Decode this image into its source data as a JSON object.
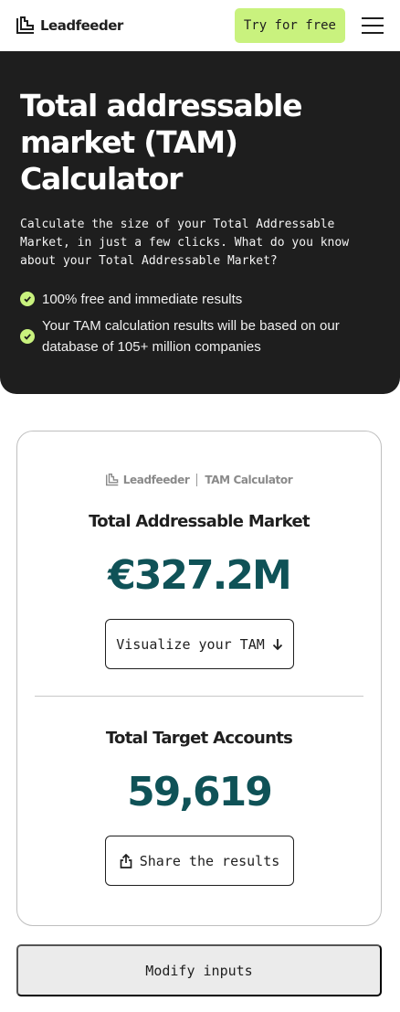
{
  "header": {
    "brand": "Leadfeeder",
    "try_label": "Try for free"
  },
  "hero": {
    "title": "Total addressable market (TAM) Calculator",
    "description": "Calculate the size of your Total Addressable Market, in just a few clicks. What do you know about your Total Addressable Market?",
    "bullets": [
      "100% free and immediate results",
      "Your TAM calculation results will be based on our database of 105+ million companies"
    ]
  },
  "card": {
    "brand": "Leadfeeder",
    "product": "TAM Calculator",
    "tam_title": "Total Addressable Market",
    "tam_value": "€327.2M",
    "visualize_label": "Visualize your TAM",
    "accounts_title": "Total Target Accounts",
    "accounts_value": "59,619",
    "share_label": "Share the results"
  },
  "footer": {
    "modify_label": "Modify inputs"
  },
  "colors": {
    "accent": "#c9f27e",
    "hero_bg": "#1e1e1e",
    "number": "#0f5257"
  },
  "icons": [
    "leadfeeder-logo-icon",
    "menu-icon",
    "check-icon",
    "arrow-down-icon",
    "share-icon"
  ]
}
